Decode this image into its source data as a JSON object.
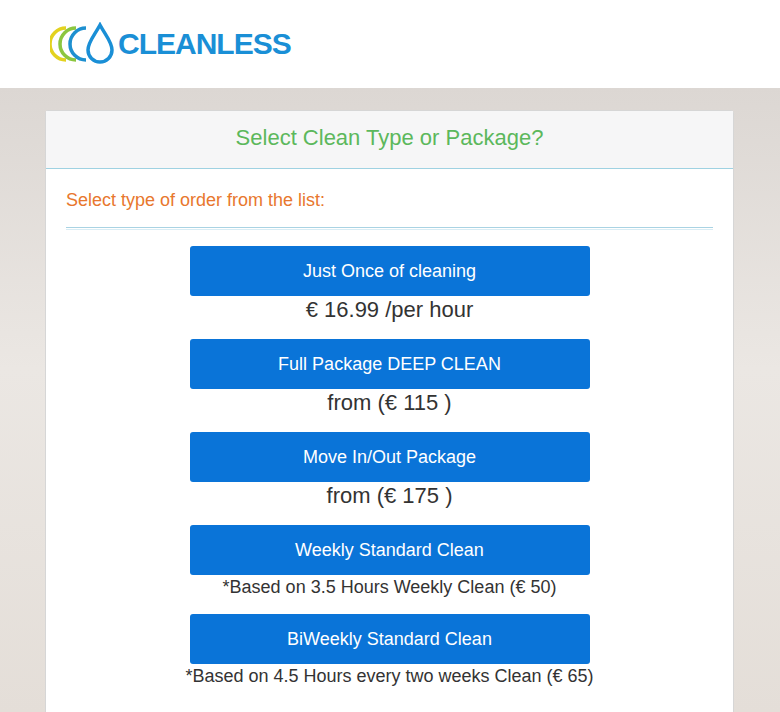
{
  "header": {
    "logo": "CLEANLESS"
  },
  "card": {
    "title": "Select Clean Type or Package?",
    "subtitle": "Select type of order from the list:"
  },
  "options": [
    {
      "label": "Just Once of cleaning",
      "price": "€ 16.99 /per hour",
      "kind": "price"
    },
    {
      "label": "Full Package DEEP CLEAN",
      "price": "from (€ 115 )",
      "kind": "price"
    },
    {
      "label": "Move In/Out Package",
      "price": "from (€ 175 )",
      "kind": "price"
    },
    {
      "label": "Weekly Standard Clean",
      "price": "*Based on 3.5 Hours Weekly Clean (€ 50)",
      "kind": "note"
    },
    {
      "label": "BiWeekly Standard Clean",
      "price": "*Based on 4.5 Hours every two weeks Clean (€ 65)",
      "kind": "note"
    }
  ]
}
